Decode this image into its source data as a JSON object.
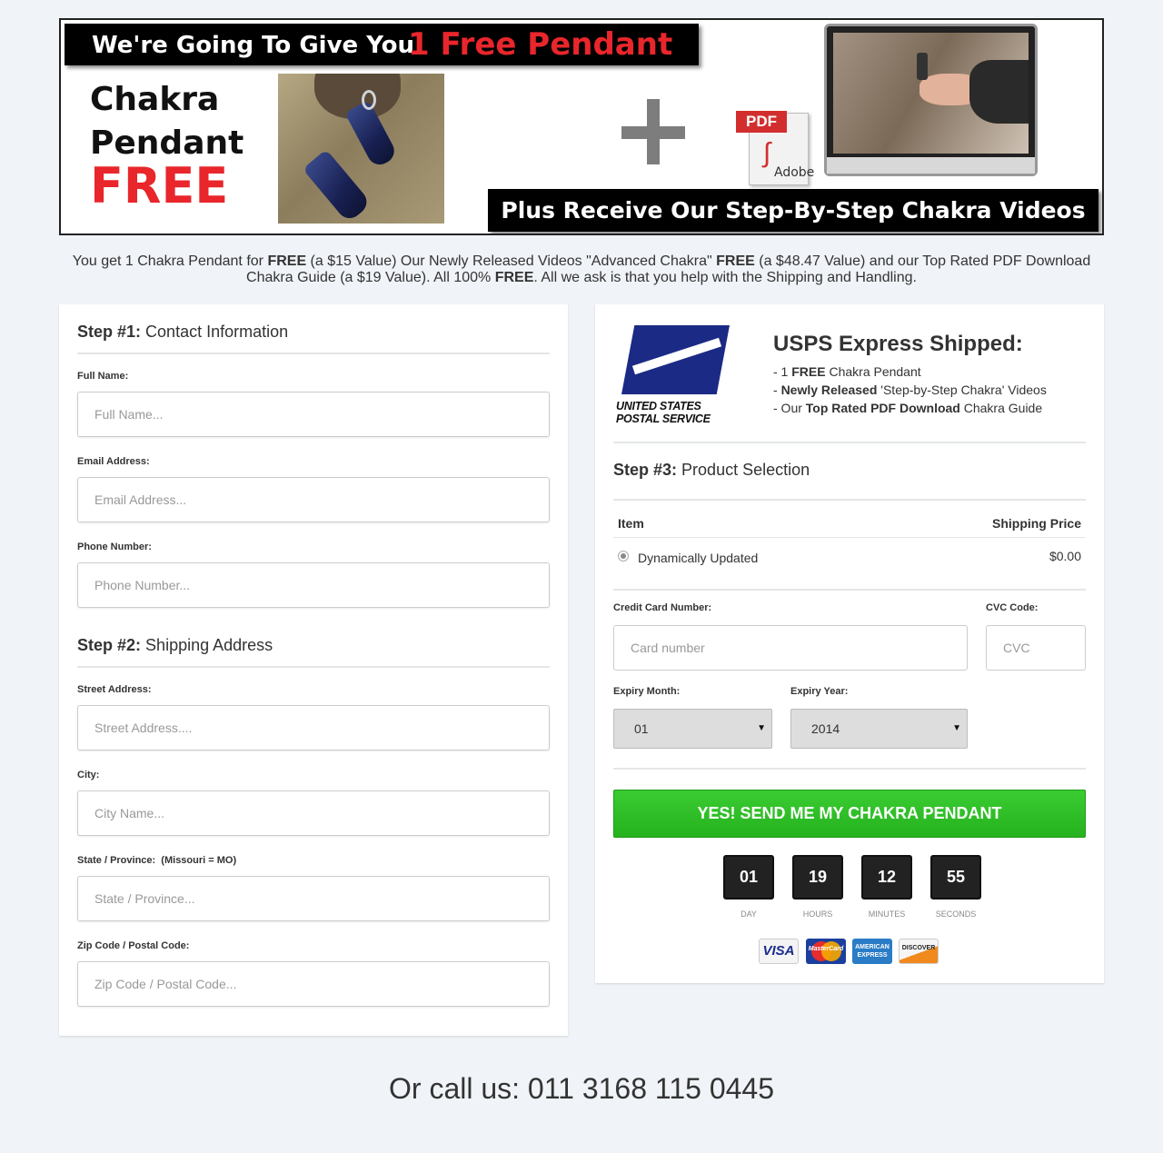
{
  "banner": {
    "headline_prefix": "We're Going To Give You",
    "headline_highlight": "1 Free Pendant",
    "left_line1": "Chakra",
    "left_line2": "Pendant",
    "left_line3": "FREE",
    "pdf_tag": "PDF",
    "pdf_brand": "Adobe",
    "bottom_bar": "Plus Receive Our Step-By-Step Chakra Videos",
    "colors": {
      "highlight": "#e8262b",
      "bar": "#000000"
    }
  },
  "intro": {
    "t1": "You get 1 Chakra Pendant for ",
    "b1": "FREE",
    "t2": " (a $15 Value) Our Newly Released Videos \"Advanced Chakra\" ",
    "b2": "FREE",
    "t3": " (a $48.47 Value) and our Top Rated PDF Download Chakra Guide (a $19 Value). All 100% ",
    "b3": "FREE",
    "t4": ". All we ask is that you help with the Shipping and Handling."
  },
  "step1": {
    "step_label": "Step #1:",
    "title": "Contact Information",
    "fields": [
      {
        "label": "Full Name:",
        "placeholder": "Full Name..."
      },
      {
        "label": "Email Address:",
        "placeholder": "Email Address..."
      },
      {
        "label": "Phone Number:",
        "placeholder": "Phone Number..."
      }
    ]
  },
  "step2": {
    "step_label": "Step #2:",
    "title": "Shipping Address",
    "fields": [
      {
        "label": "Street Address:",
        "placeholder": "Street Address...."
      },
      {
        "label": "City:",
        "placeholder": "City Name..."
      },
      {
        "label": "State / Province:  (Missouri = MO)",
        "placeholder": "State / Province..."
      },
      {
        "label": "Zip Code / Postal Code:",
        "placeholder": "Zip Code / Postal Code..."
      }
    ]
  },
  "shipping": {
    "logo_line1": "UNITED STATES",
    "logo_line2": "POSTAL SERVICE",
    "title": "USPS Express Shipped:",
    "items": [
      {
        "pre": "- 1 ",
        "bold": "FREE",
        "post": " Chakra Pendant"
      },
      {
        "pre": "- ",
        "bold": "Newly Released",
        "post": " 'Step-by-Step Chakra' Videos"
      },
      {
        "pre": "- Our ",
        "bold": "Top Rated PDF Download",
        "post": " Chakra Guide"
      }
    ]
  },
  "step3": {
    "step_label": "Step #3:",
    "title": "Product Selection",
    "col_item": "Item",
    "col_price": "Shipping Price",
    "product_name": "Dynamically Updated",
    "product_price": "$0.00"
  },
  "payment": {
    "card_label": "Credit Card Number:",
    "card_placeholder": "Card number",
    "cvc_label": "CVC Code:",
    "cvc_placeholder": "CVC",
    "month_label": "Expiry Month:",
    "month_value": "01",
    "year_label": "Expiry Year:",
    "year_value": "2014"
  },
  "cta": {
    "label": "YES! SEND ME MY CHAKRA PENDANT",
    "color": "#2fbf27"
  },
  "timer": [
    {
      "value": "01",
      "label": "DAY"
    },
    {
      "value": "19",
      "label": "HOURS"
    },
    {
      "value": "12",
      "label": "MINUTES"
    },
    {
      "value": "55",
      "label": "SECONDS"
    }
  ],
  "cards": {
    "visa": "VISA",
    "mastercard": "MasterCard",
    "amex_1": "AMERICAN",
    "amex_2": "EXPRESS",
    "discover": "DISCOVER"
  },
  "footer": {
    "call": "Or call us: 011 3168 115 0445"
  }
}
